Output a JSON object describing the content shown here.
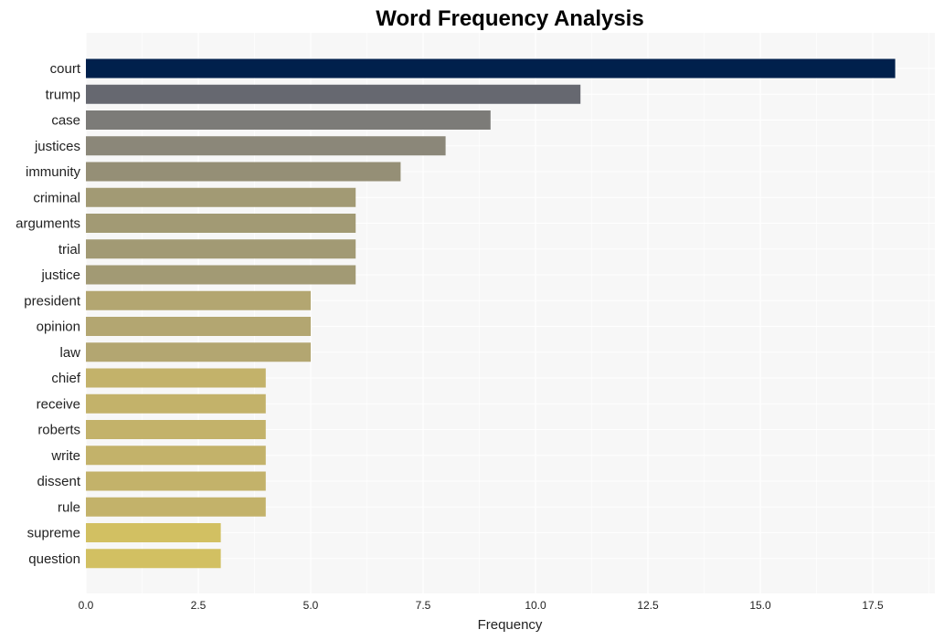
{
  "chart_data": {
    "type": "bar",
    "orientation": "horizontal",
    "title": "Word Frequency Analysis",
    "xlabel": "Frequency",
    "ylabel": "",
    "xlim": [
      0,
      18.9
    ],
    "xticks": [
      0.0,
      2.5,
      5.0,
      7.5,
      10.0,
      12.5,
      15.0,
      17.5
    ],
    "xtick_labels": [
      "0.0",
      "2.5",
      "5.0",
      "7.5",
      "10.0",
      "12.5",
      "15.0",
      "17.5"
    ],
    "grid": true,
    "categories": [
      "court",
      "trump",
      "case",
      "justices",
      "immunity",
      "criminal",
      "arguments",
      "trial",
      "justice",
      "president",
      "opinion",
      "law",
      "chief",
      "receive",
      "roberts",
      "write",
      "dissent",
      "rule",
      "supreme",
      "question"
    ],
    "values": [
      18,
      11,
      9,
      8,
      7,
      6,
      6,
      6,
      6,
      5,
      5,
      5,
      4,
      4,
      4,
      4,
      4,
      4,
      3,
      3
    ],
    "colors": [
      "#00204c",
      "#666870",
      "#7c7b78",
      "#8b8779",
      "#958f76",
      "#a29a74",
      "#a29a74",
      "#a29a74",
      "#a29a74",
      "#b3a671",
      "#b3a671",
      "#b3a671",
      "#c3b26a",
      "#c3b26a",
      "#c3b26a",
      "#c3b26a",
      "#c3b26a",
      "#c3b26a",
      "#d2c062",
      "#d2c062"
    ],
    "background": "#f7f7f7"
  }
}
